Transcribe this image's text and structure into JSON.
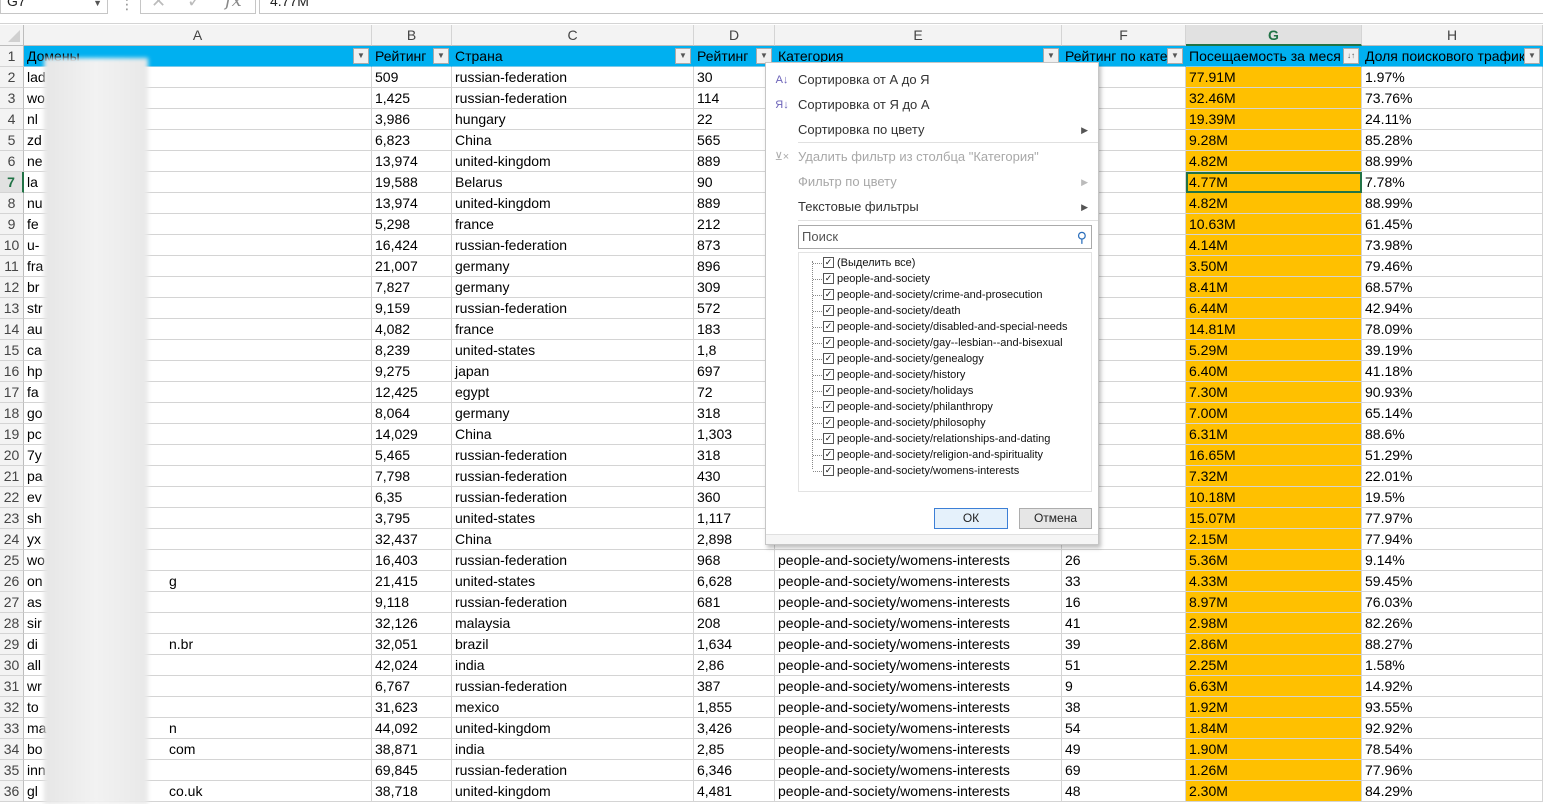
{
  "formula_bar": {
    "name_box": "G7",
    "input": "4.77M"
  },
  "columns": [
    "A",
    "B",
    "C",
    "D",
    "E",
    "F",
    "G",
    "H"
  ],
  "selected_column": "G",
  "selected_row": "7",
  "headers": [
    "Домены",
    "Рейтинг",
    "Страна",
    "Рейтинг",
    "Категория",
    "Рейтинг по кате",
    "Посещаемость за меся",
    "Доля поискового трафика"
  ],
  "colors": {
    "header_bg": "#00b0f0",
    "highlight": "#ffc000",
    "select": "#217346"
  },
  "rows": [
    {
      "n": "2",
      "a": "lad",
      "a2": "",
      "b": "509",
      "c": "russian-federation",
      "d": "30",
      "e": "",
      "f": "",
      "g": "77.91M",
      "h": "1.97%"
    },
    {
      "n": "3",
      "a": "wo",
      "a2": "",
      "b": "1,425",
      "c": "russian-federation",
      "d": "114",
      "e": "",
      "f": "",
      "g": "32.46M",
      "h": "73.76%"
    },
    {
      "n": "4",
      "a": "nl",
      "a2": "",
      "b": "3,986",
      "c": "hungary",
      "d": "22",
      "e": "",
      "f": "",
      "g": "19.39M",
      "h": "24.11%"
    },
    {
      "n": "5",
      "a": "zd",
      "a2": "",
      "b": "6,823",
      "c": "China",
      "d": "565",
      "e": "",
      "f": "",
      "g": "9.28M",
      "h": "85.28%"
    },
    {
      "n": "6",
      "a": "ne",
      "a2": "",
      "b": "13,974",
      "c": "united-kingdom",
      "d": "889",
      "e": "",
      "f": "",
      "g": "4.82M",
      "h": "88.99%"
    },
    {
      "n": "7",
      "a": "la",
      "a2": "",
      "b": "19,588",
      "c": "Belarus",
      "d": "90",
      "e": "",
      "f": "",
      "g": "4.77M",
      "h": "7.78%"
    },
    {
      "n": "8",
      "a": "nu",
      "a2": "",
      "b": "13,974",
      "c": "united-kingdom",
      "d": "889",
      "e": "",
      "f": "",
      "g": "4.82M",
      "h": "88.99%"
    },
    {
      "n": "9",
      "a": "fe",
      "a2": "",
      "b": "5,298",
      "c": "france",
      "d": "212",
      "e": "",
      "f": "",
      "g": "10.63M",
      "h": "61.45%"
    },
    {
      "n": "10",
      "a": "u-",
      "a2": "",
      "b": "16,424",
      "c": "russian-federation",
      "d": "873",
      "e": "",
      "f": "",
      "g": "4.14M",
      "h": "73.98%"
    },
    {
      "n": "11",
      "a": "fra",
      "a2": "",
      "b": "21,007",
      "c": "germany",
      "d": "896",
      "e": "",
      "f": "",
      "g": "3.50M",
      "h": "79.46%"
    },
    {
      "n": "12",
      "a": "br",
      "a2": "",
      "b": "7,827",
      "c": "germany",
      "d": "309",
      "e": "",
      "f": "",
      "g": "8.41M",
      "h": "68.57%"
    },
    {
      "n": "13",
      "a": "str",
      "a2": "",
      "b": "9,159",
      "c": "russian-federation",
      "d": "572",
      "e": "",
      "f": "",
      "g": "6.44M",
      "h": "42.94%"
    },
    {
      "n": "14",
      "a": "au",
      "a2": "",
      "b": "4,082",
      "c": "france",
      "d": "183",
      "e": "",
      "f": "",
      "g": "14.81M",
      "h": "78.09%"
    },
    {
      "n": "15",
      "a": "ca",
      "a2": "",
      "b": "8,239",
      "c": "united-states",
      "d": "1,8",
      "e": "",
      "f": "",
      "g": "5.29M",
      "h": "39.19%"
    },
    {
      "n": "16",
      "a": "hp",
      "a2": "",
      "b": "9,275",
      "c": "japan",
      "d": "697",
      "e": "",
      "f": "",
      "g": "6.40M",
      "h": "41.18%"
    },
    {
      "n": "17",
      "a": "fa",
      "a2": "",
      "b": "12,425",
      "c": "egypt",
      "d": "72",
      "e": "",
      "f": "",
      "g": "7.30M",
      "h": "90.93%"
    },
    {
      "n": "18",
      "a": "go",
      "a2": "",
      "b": "8,064",
      "c": "germany",
      "d": "318",
      "e": "",
      "f": "",
      "g": "7.00M",
      "h": "65.14%"
    },
    {
      "n": "19",
      "a": "pc",
      "a2": "",
      "b": "14,029",
      "c": "China",
      "d": "1,303",
      "e": "",
      "f": "",
      "g": "6.31M",
      "h": "88.6%"
    },
    {
      "n": "20",
      "a": "7y",
      "a2": "",
      "b": "5,465",
      "c": "russian-federation",
      "d": "318",
      "e": "",
      "f": "",
      "g": "16.65M",
      "h": "51.29%"
    },
    {
      "n": "21",
      "a": "pa",
      "a2": "",
      "b": "7,798",
      "c": "russian-federation",
      "d": "430",
      "e": "",
      "f": "",
      "g": "7.32M",
      "h": "22.01%"
    },
    {
      "n": "22",
      "a": "ev",
      "a2": "",
      "b": "6,35",
      "c": "russian-federation",
      "d": "360",
      "e": "",
      "f": "",
      "g": "10.18M",
      "h": "19.5%"
    },
    {
      "n": "23",
      "a": "sh",
      "a2": "",
      "b": "3,795",
      "c": "united-states",
      "d": "1,117",
      "e": "",
      "f": "",
      "g": "15.07M",
      "h": "77.97%"
    },
    {
      "n": "24",
      "a": "yx",
      "a2": "",
      "b": "32,437",
      "c": "China",
      "d": "2,898",
      "e": "",
      "f": "",
      "g": "2.15M",
      "h": "77.94%"
    },
    {
      "n": "25",
      "a": "wo",
      "a2": "",
      "b": "16,403",
      "c": "russian-federation",
      "d": "968",
      "e": "people-and-society/womens-interests",
      "f": "26",
      "g": "5.36M",
      "h": "9.14%"
    },
    {
      "n": "26",
      "a": "on",
      "a2": "g",
      "b": "21,415",
      "c": "united-states",
      "d": "6,628",
      "e": "people-and-society/womens-interests",
      "f": "33",
      "g": "4.33M",
      "h": "59.45%"
    },
    {
      "n": "27",
      "a": "as",
      "a2": "",
      "b": "9,118",
      "c": "russian-federation",
      "d": "681",
      "e": "people-and-society/womens-interests",
      "f": "16",
      "g": "8.97M",
      "h": "76.03%"
    },
    {
      "n": "28",
      "a": "sir",
      "a2": "",
      "b": "32,126",
      "c": "malaysia",
      "d": "208",
      "e": "people-and-society/womens-interests",
      "f": "41",
      "g": "2.98M",
      "h": "82.26%"
    },
    {
      "n": "29",
      "a": "di",
      "a2": "n.br",
      "b": "32,051",
      "c": "brazil",
      "d": "1,634",
      "e": "people-and-society/womens-interests",
      "f": "39",
      "g": "2.86M",
      "h": "88.27%"
    },
    {
      "n": "30",
      "a": "all",
      "a2": "",
      "b": "42,024",
      "c": "india",
      "d": "2,86",
      "e": "people-and-society/womens-interests",
      "f": "51",
      "g": "2.25M",
      "h": "1.58%"
    },
    {
      "n": "31",
      "a": "wr",
      "a2": "",
      "b": "6,767",
      "c": "russian-federation",
      "d": "387",
      "e": "people-and-society/womens-interests",
      "f": "9",
      "g": "6.63M",
      "h": "14.92%"
    },
    {
      "n": "32",
      "a": "to",
      "a2": "",
      "b": "31,623",
      "c": "mexico",
      "d": "1,855",
      "e": "people-and-society/womens-interests",
      "f": "38",
      "g": "1.92M",
      "h": "93.55%"
    },
    {
      "n": "33",
      "a": "ma",
      "a2": "n",
      "b": "44,092",
      "c": "united-kingdom",
      "d": "3,426",
      "e": "people-and-society/womens-interests",
      "f": "54",
      "g": "1.84M",
      "h": "92.92%"
    },
    {
      "n": "34",
      "a": "bo",
      "a2": "com",
      "b": "38,871",
      "c": "india",
      "d": "2,85",
      "e": "people-and-society/womens-interests",
      "f": "49",
      "g": "1.90M",
      "h": "78.54%"
    },
    {
      "n": "35",
      "a": "inn",
      "a2": "",
      "b": "69,845",
      "c": "russian-federation",
      "d": "6,346",
      "e": "people-and-society/womens-interests",
      "f": "69",
      "g": "1.26M",
      "h": "77.96%"
    },
    {
      "n": "36",
      "a": "gl",
      "a2": "co.uk",
      "b": "38,718",
      "c": "united-kingdom",
      "d": "4,481",
      "e": "people-and-society/womens-interests",
      "f": "48",
      "g": "2.30M",
      "h": "84.29%"
    }
  ],
  "filter_menu": {
    "sort_az": "Сортировка от А до Я",
    "sort_za": "Сортировка от Я до А",
    "sort_color": "Сортировка по цвету",
    "clear_filter": "Удалить фильтр из столбца \"Категория\"",
    "filter_color": "Фильтр по цвету",
    "text_filters": "Текстовые фильтры",
    "search_placeholder": "Поиск",
    "items": [
      "(Выделить все)",
      "people-and-society",
      "people-and-society/crime-and-prosecution",
      "people-and-society/death",
      "people-and-society/disabled-and-special-needs",
      "people-and-society/gay--lesbian--and-bisexual",
      "people-and-society/genealogy",
      "people-and-society/history",
      "people-and-society/holidays",
      "people-and-society/philanthropy",
      "people-and-society/philosophy",
      "people-and-society/relationships-and-dating",
      "people-and-society/religion-and-spirituality",
      "people-and-society/womens-interests"
    ],
    "ok": "ОК",
    "cancel": "Отмена"
  }
}
